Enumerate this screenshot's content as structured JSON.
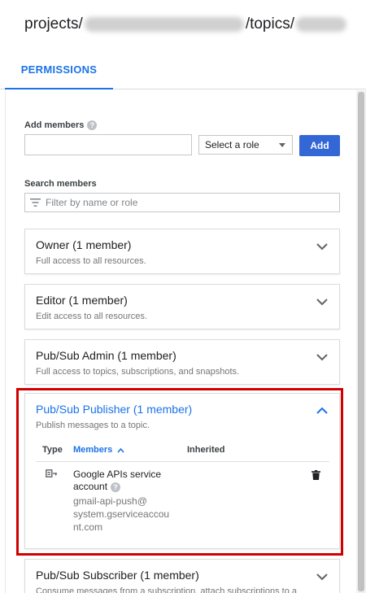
{
  "header": {
    "prefix": "projects/",
    "middle": "/topics/"
  },
  "tabs": [
    {
      "label": "PERMISSIONS"
    }
  ],
  "add_members": {
    "label": "Add members",
    "role_select": "Select a role",
    "add_label": "Add"
  },
  "search": {
    "label": "Search members",
    "placeholder": "Filter by name or role"
  },
  "roles": [
    {
      "title": "Owner (1 member)",
      "desc": "Full access to all resources."
    },
    {
      "title": "Editor (1 member)",
      "desc": "Edit access to all resources."
    },
    {
      "title": "Pub/Sub Admin (1 member)",
      "desc": "Full access to topics, subscriptions, and snapshots."
    },
    {
      "title": "Pub/Sub Publisher (1 member)",
      "desc": "Publish messages to a topic."
    },
    {
      "title": "Pub/Sub Subscriber (1 member)",
      "desc": "Consume messages from a subscription, attach subscriptions to a"
    }
  ],
  "publisher_table": {
    "col_type": "Type",
    "col_members": "Members",
    "col_inherited": "Inherited",
    "member_name": "Google APIs service account",
    "member_email_lines": [
      "gmail-api-push@",
      "system.gserviceaccou",
      "nt.com"
    ]
  },
  "colors": {
    "accent": "#1a73e8",
    "add_button": "#3367d6",
    "highlight": "#d10000"
  }
}
